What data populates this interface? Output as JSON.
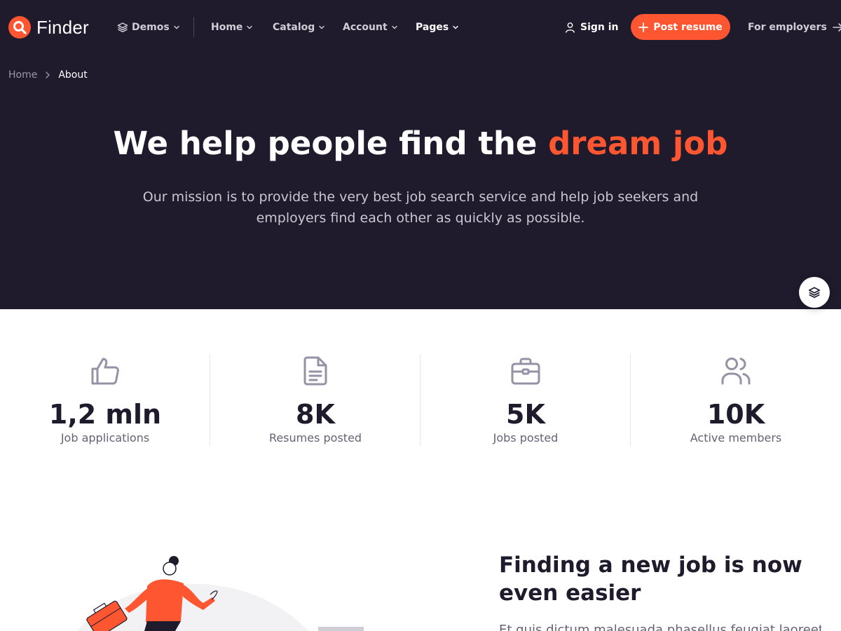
{
  "brand": {
    "name": "Finder",
    "logo_icon": "search-icon",
    "accent_color": "#fd5631"
  },
  "nav": {
    "demos": "Demos",
    "home": "Home",
    "catalog": "Catalog",
    "account": "Account",
    "pages": "Pages",
    "sign_in": "Sign in",
    "post_resume": "Post resume",
    "for_employers": "For employers"
  },
  "breadcrumb": {
    "home": "Home",
    "current": "About"
  },
  "hero": {
    "title_main": "We help people find the ",
    "title_accent": "dream job",
    "subtitle": "Our mission is to provide the very best job search service and help job seekers and employers find each other as quickly as possible."
  },
  "stats": [
    {
      "icon": "thumbs-up-icon",
      "value": "1,2 mln",
      "label": "Job applications"
    },
    {
      "icon": "document-icon",
      "value": "8K",
      "label": "Resumes posted"
    },
    {
      "icon": "briefcase-icon",
      "value": "5K",
      "label": "Jobs posted"
    },
    {
      "icon": "users-icon",
      "value": "10K",
      "label": "Active members"
    }
  ],
  "section": {
    "title": "Finding a new job is now even easier",
    "text": "Et quis dictum malesuada phasellus feugiat laoreet"
  },
  "colors": {
    "hero_bg": "#1f1b2d",
    "accent": "#fd5631"
  }
}
